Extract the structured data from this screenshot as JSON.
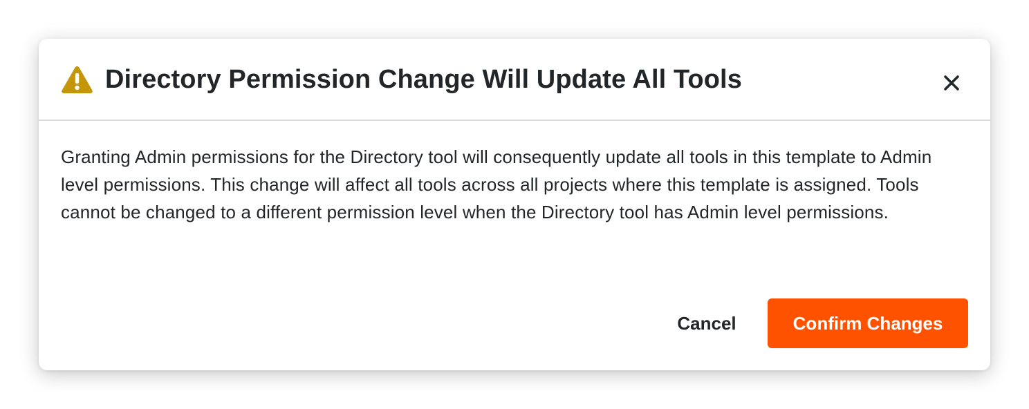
{
  "dialog": {
    "title": "Directory Permission Change Will Update All Tools",
    "body": "Granting Admin permissions for the Directory tool will consequently update all tools in this template to Admin level permissions. This change will affect all tools across all projects where this template is assigned. Tools cannot be changed to a different permission level when the Directory tool has Admin level permissions.",
    "icons": {
      "warning": "warning-icon",
      "close": "close-icon"
    },
    "actions": {
      "cancel_label": "Cancel",
      "confirm_label": "Confirm Changes"
    }
  },
  "colors": {
    "warning": "#c4960c",
    "primary": "#ff5200",
    "text": "#232628",
    "divider": "#dcdcdc"
  }
}
